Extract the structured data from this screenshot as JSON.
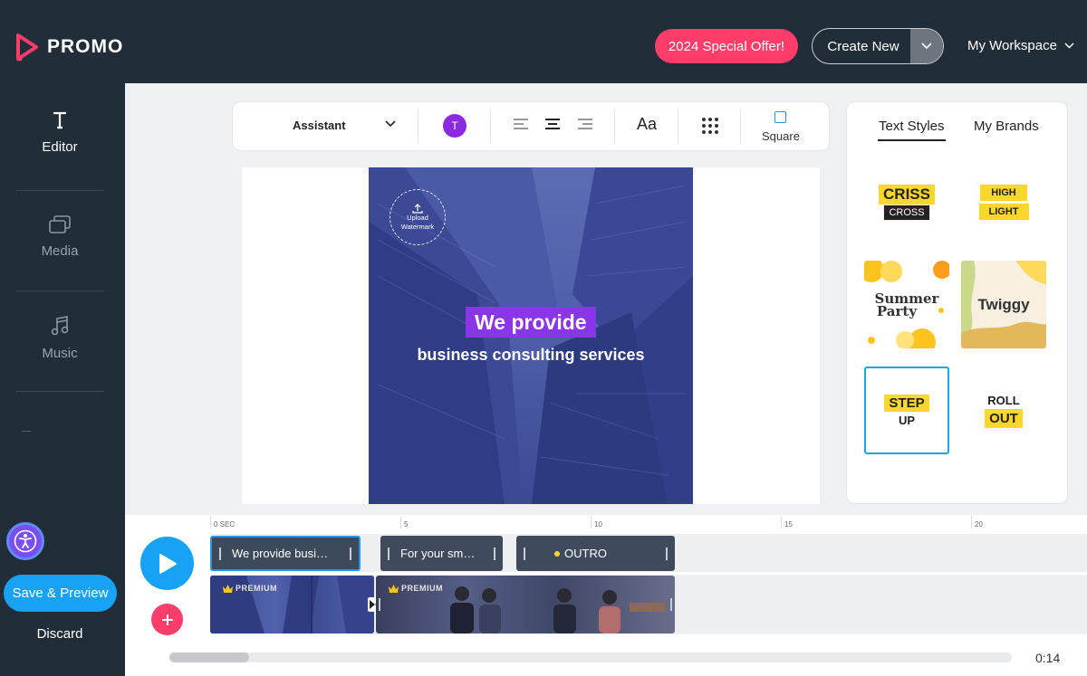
{
  "app": {
    "name": "PROMO"
  },
  "header": {
    "offer_label": "2024 Special Offer!",
    "create_label": "Create New",
    "workspace_label": "My Workspace"
  },
  "sidebar": {
    "items": [
      {
        "label": "Editor",
        "icon": "text-t-icon",
        "active": true
      },
      {
        "label": "Media",
        "icon": "media-stack-icon",
        "active": false
      },
      {
        "label": "Music",
        "icon": "music-note-icon",
        "active": false
      }
    ],
    "save_label": "Save & Preview",
    "discard_label": "Discard"
  },
  "toolbar": {
    "font": "Assistant",
    "color_letter": "T",
    "color_value": "#8a2be2",
    "size_label": "Aa",
    "ratio_label": "Square"
  },
  "canvas": {
    "watermark_label": "Upload Watermark",
    "headline": "We provide",
    "subline": "business consulting services"
  },
  "styles_panel": {
    "tabs": [
      "Text Styles",
      "My Brands"
    ],
    "cards": [
      {
        "name": "criss-cross",
        "lines": [
          "CRISS",
          "CROSS"
        ]
      },
      {
        "name": "high-light",
        "lines": [
          "HIGH",
          "LIGHT"
        ]
      },
      {
        "name": "summer-party",
        "lines": [
          "Summer",
          "Party"
        ]
      },
      {
        "name": "twiggy",
        "lines": [
          "Twiggy"
        ]
      },
      {
        "name": "step-up",
        "lines": [
          "STEP",
          "UP"
        ],
        "selected": true
      },
      {
        "name": "roll-out",
        "lines": [
          "ROLL",
          "OUT"
        ]
      }
    ]
  },
  "timeline": {
    "ruler": [
      "0 SEC",
      "5",
      "10",
      "15",
      "20"
    ],
    "text_clips": [
      {
        "label": "We provide busi…",
        "selected": true
      },
      {
        "label": "For your sm…",
        "selected": false
      },
      {
        "label": "OUTRO",
        "selected": false
      }
    ],
    "media_clips": [
      {
        "badge": "PREMIUM"
      },
      {
        "badge": "PREMIUM"
      }
    ],
    "current_time": "0:14",
    "scroll_position": 0.0
  },
  "colors": {
    "dark": "#222d3a",
    "accent_pink": "#ff3d6b",
    "accent_blue": "#17a2f5",
    "purple": "#8a35e8",
    "yellow": "#ffd62c"
  }
}
